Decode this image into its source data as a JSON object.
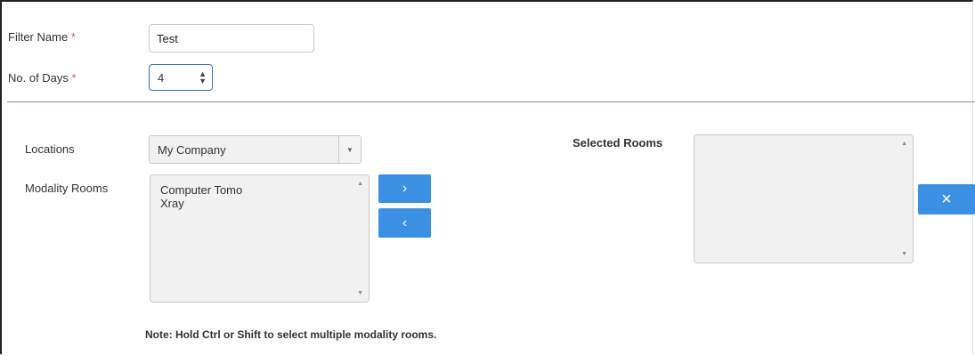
{
  "filter": {
    "name_label": "Filter Name",
    "name_value": "Test",
    "days_label": "No. of Days",
    "days_value": "4",
    "required_mark": "*"
  },
  "locations": {
    "label": "Locations",
    "selected": "My Company"
  },
  "modality_rooms": {
    "label": "Modality Rooms",
    "items": [
      "Computer Tomo",
      "Xray"
    ]
  },
  "buttons": {
    "add_symbol": "›",
    "remove_symbol": "‹",
    "clear_symbol": "×"
  },
  "selected_rooms": {
    "label": "Selected Rooms",
    "items": []
  },
  "note": "Note: Hold Ctrl or Shift to select multiple modality rooms.",
  "colors": {
    "button": "#3c90e4",
    "required": "#d9534f",
    "focus_border": "#3b73b9"
  },
  "icons": {
    "spinner": "spinner-icon",
    "select_caret": "caret-down-icon",
    "scroll_up": "scroll-up-icon",
    "scroll_down": "scroll-down-icon"
  }
}
